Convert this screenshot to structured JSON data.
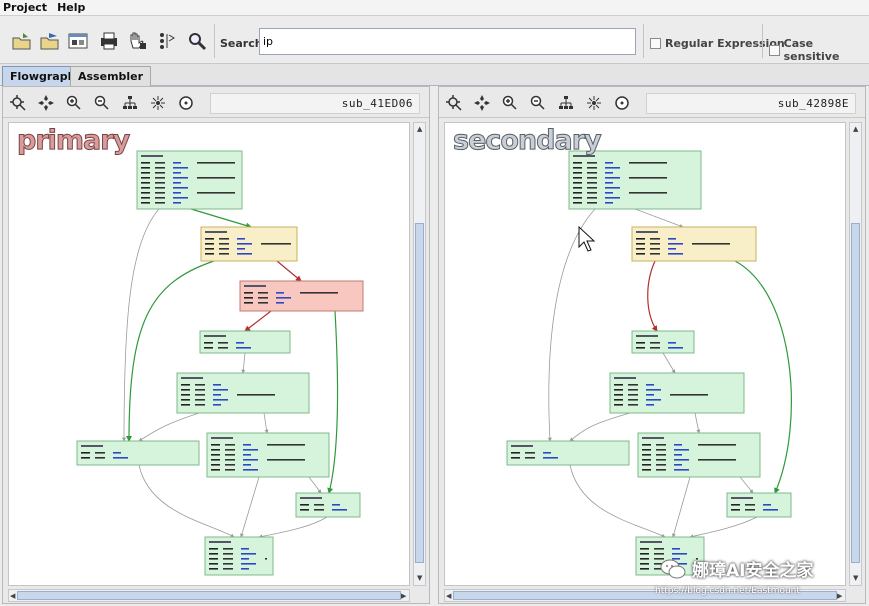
{
  "menu": [
    {
      "label": "Project"
    },
    {
      "label": "Help"
    }
  ],
  "toolbar": {
    "search_label": "Search",
    "search_value": "ip",
    "options": [
      {
        "label": "Regular Expression"
      },
      {
        "label": "Case sensitive"
      }
    ]
  },
  "tabs": [
    {
      "label": "Flowgraph",
      "active": true
    },
    {
      "label": "Assembler",
      "active": false
    }
  ],
  "panes": [
    {
      "function": "sub_41ED06",
      "watermark": "primary"
    },
    {
      "function": "sub_42898E",
      "watermark": "secondary"
    }
  ],
  "colors": {
    "node_green": "#d6f4dc",
    "node_yellow": "#f8efc8",
    "node_red": "#f8c8c0",
    "edge_green": "#2e9a3a",
    "edge_red": "#b23030",
    "edge_gray": "#9a9a9a"
  },
  "watermark": {
    "brand": "娜璋AI安全之家",
    "url": "https://blog.csdn.net/Eastmount"
  }
}
